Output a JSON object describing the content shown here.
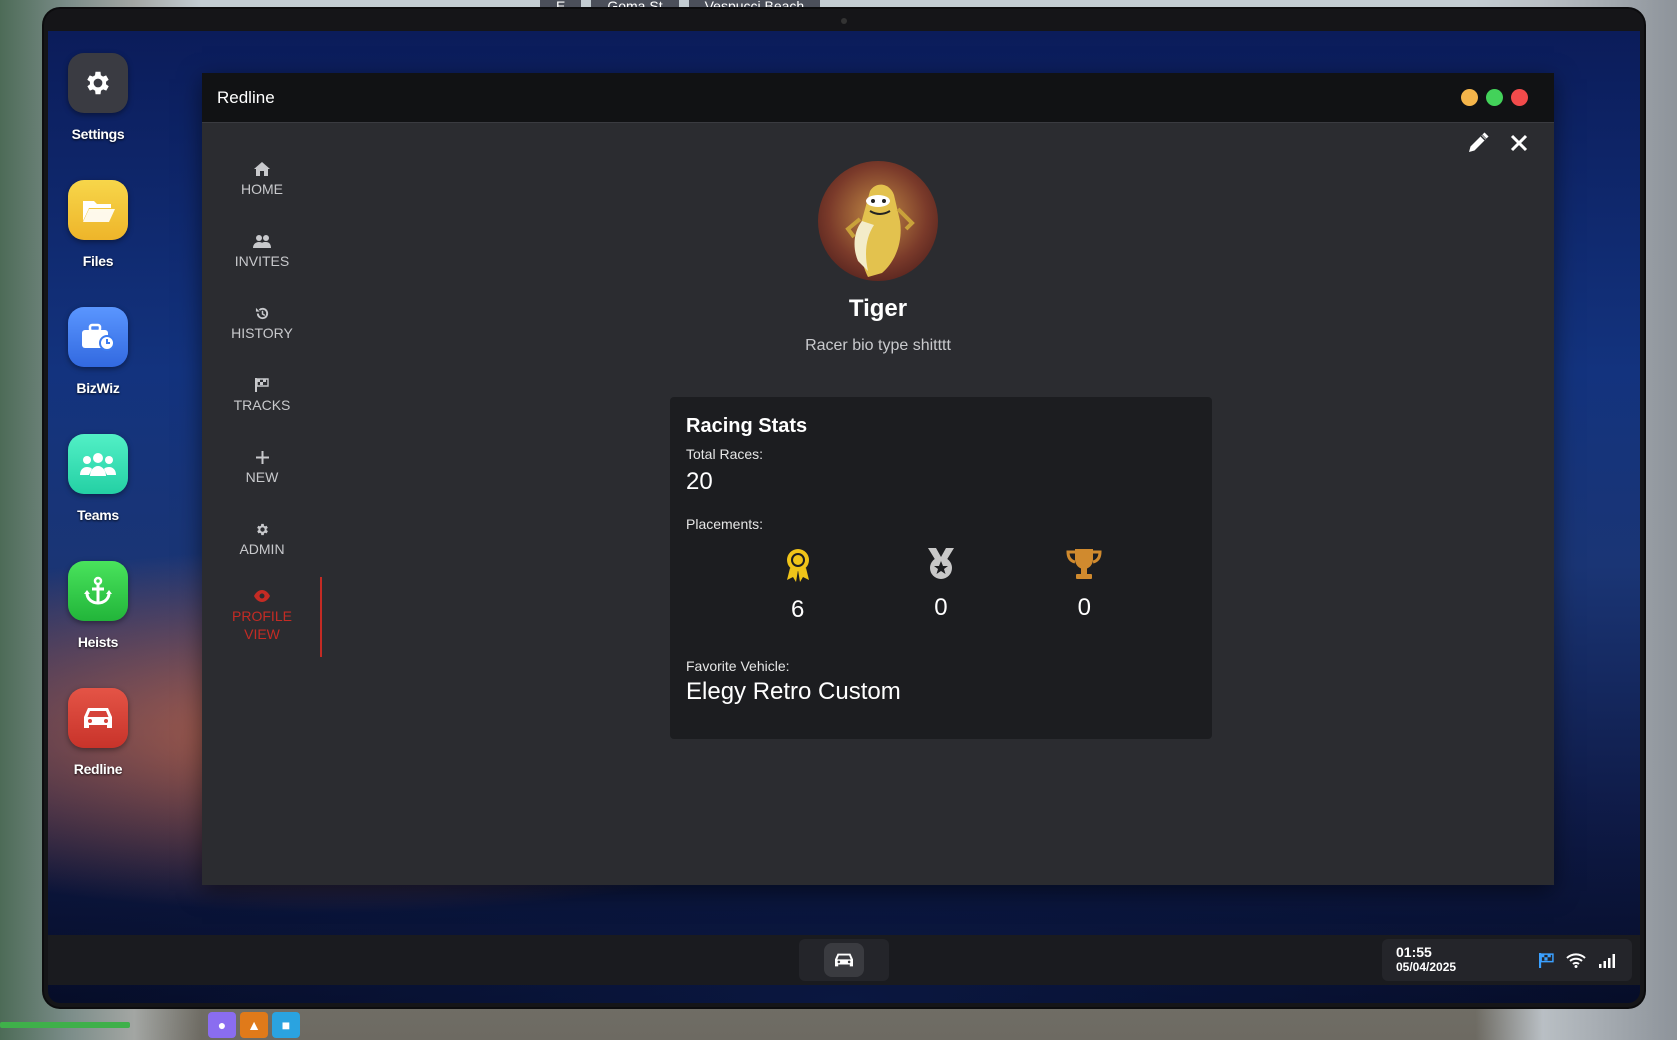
{
  "world": {
    "street_labels": [
      "E",
      "Goma St",
      "Vespucci Beach"
    ]
  },
  "desktop": {
    "apps": [
      {
        "label": "Settings",
        "icon": "gear-icon",
        "color": "#3a3b42"
      },
      {
        "label": "Files",
        "icon": "folder-icon",
        "color": "#f2c636"
      },
      {
        "label": "BizWiz",
        "icon": "briefcase-icon",
        "color": "#3d7cf0"
      },
      {
        "label": "Teams",
        "icon": "people-icon",
        "color": "#2fe0b4"
      },
      {
        "label": "Heists",
        "icon": "anchor-icon",
        "color": "#2fc24a"
      },
      {
        "label": "Redline",
        "icon": "car-icon",
        "color": "#d6433a"
      }
    ]
  },
  "window": {
    "title": "Redline",
    "controls": {
      "minimize_color": "#f5b54a",
      "maximize_color": "#43d25a",
      "close_color": "#f24b4b"
    }
  },
  "nav": {
    "items": [
      {
        "label": "HOME",
        "icon": "home-icon"
      },
      {
        "label": "INVITES",
        "icon": "users-icon"
      },
      {
        "label": "HISTORY",
        "icon": "history-icon"
      },
      {
        "label": "TRACKS",
        "icon": "flag-icon"
      },
      {
        "label": "NEW",
        "icon": "plus-icon"
      },
      {
        "label": "ADMIN",
        "icon": "gear-icon"
      }
    ],
    "active": {
      "label_line1": "PROFILE",
      "label_line2": "VIEW",
      "icon": "eye-icon",
      "color": "#c42b24"
    }
  },
  "profile": {
    "name": "Tiger",
    "bio": "Racer bio type shitttt"
  },
  "stats": {
    "title": "Racing Stats",
    "total_races_label": "Total Races:",
    "total_races": "20",
    "placements_label": "Placements:",
    "placements": [
      {
        "icon": "gold-award-icon",
        "value": "6",
        "color": "#f0c419"
      },
      {
        "icon": "silver-medal-icon",
        "value": "0",
        "color": "#c8c8c8"
      },
      {
        "icon": "bronze-trophy-icon",
        "value": "0",
        "color": "#d08a2e"
      }
    ],
    "favorite_vehicle_label": "Favorite Vehicle:",
    "favorite_vehicle": "Elegy Retro Custom"
  },
  "taskbar": {
    "time": "01:55",
    "date": "05/04/2025",
    "flag_color": "#3aa0ff"
  }
}
